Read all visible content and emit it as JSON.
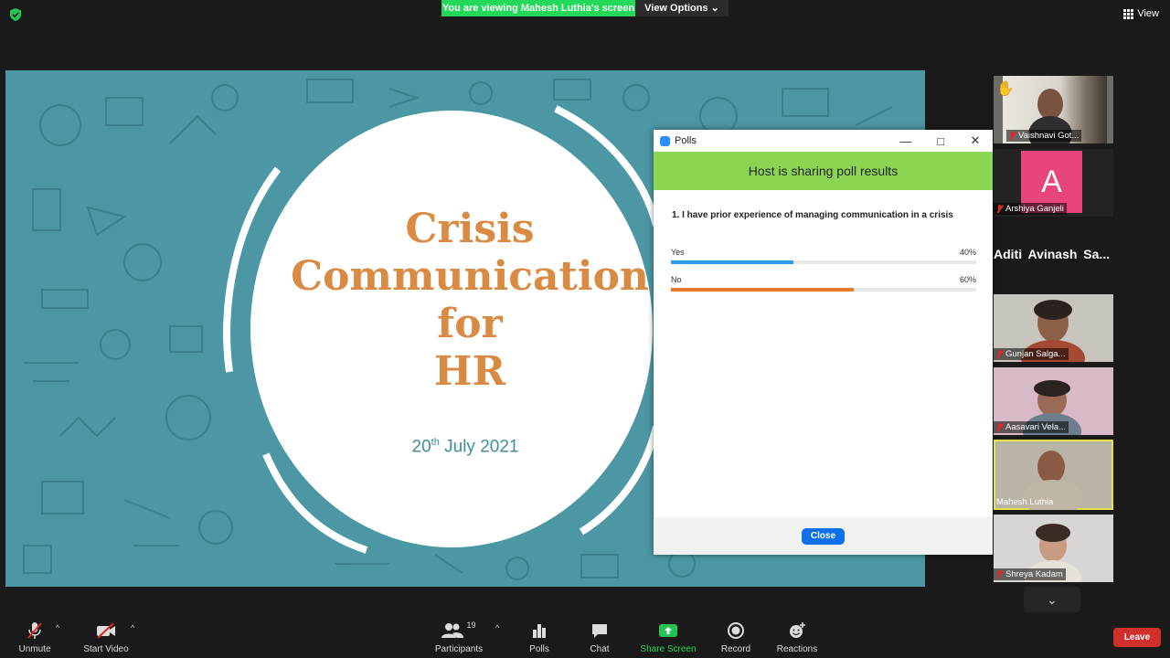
{
  "banner": {
    "text": "You are viewing Mahesh Luthia's screen",
    "view_options": "View Options ⌄"
  },
  "view_button": "View",
  "slide": {
    "title_lines": [
      "Crisis",
      "Communication",
      "for",
      "HR"
    ],
    "date_day": "20",
    "date_sup": "th",
    "date_rest": "July 2021"
  },
  "poll": {
    "window_title": "Polls",
    "header": "Host is sharing poll results",
    "question": "1. I have prior experience of managing communication in a crisis",
    "options": [
      {
        "label": "Yes",
        "percent_text": "40%",
        "value": 0.4,
        "color": "#2d9cf0"
      },
      {
        "label": "No",
        "percent_text": "60%",
        "value": 0.6,
        "color": "#e8792b"
      }
    ],
    "close_label": "Close"
  },
  "participants": [
    {
      "name": "Vaishnavi Got...",
      "raised_hand": true
    },
    {
      "name": "Arshiya Ganjeli",
      "initial": "A",
      "avatar_color": "#e8457a"
    },
    {
      "name": "Aditi Avinash Sa..."
    },
    {
      "name": "Gunjan Salga..."
    },
    {
      "name": "Aasavari Vela..."
    },
    {
      "name": "Mahesh Luthia",
      "active_speaker": true
    },
    {
      "name": "Shreya Kadam"
    }
  ],
  "toolbar": {
    "unmute": "Unmute",
    "start_video": "Start Video",
    "participants": "Participants",
    "participants_count": "19",
    "polls": "Polls",
    "chat": "Chat",
    "share_screen": "Share Screen",
    "record": "Record",
    "reactions": "Reactions",
    "leave": "Leave"
  }
}
